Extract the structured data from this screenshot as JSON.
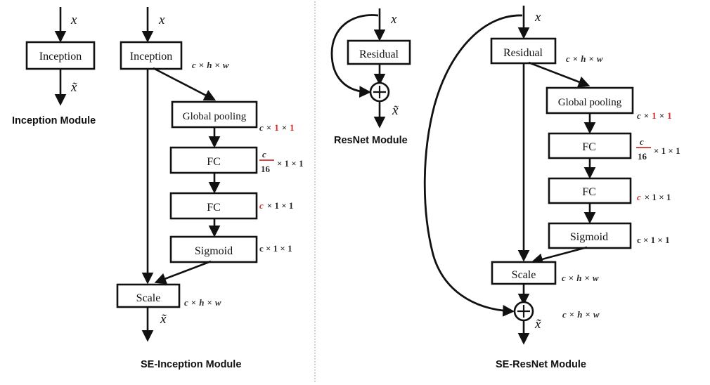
{
  "figure": {
    "panels": [
      {
        "id": "inception-module",
        "caption": "Inception Module",
        "input_var": "x",
        "output_var": "x̃",
        "blocks": [
          {
            "label": "Inception"
          }
        ]
      },
      {
        "id": "se-inception-module",
        "caption": "SE-Inception Module",
        "input_var": "x",
        "output_var": "x̃",
        "blocks": [
          {
            "label": "Inception",
            "dim": "c × h × w"
          },
          {
            "label": "Global pooling",
            "dim": "c × 1 × 1"
          },
          {
            "label": "FC",
            "dim": "c/16 × 1 × 1"
          },
          {
            "label": "FC",
            "dim": "c × 1 × 1"
          },
          {
            "label": "Sigmoid",
            "dim": "c × 1 × 1"
          },
          {
            "label": "Scale",
            "dim": "c × h × w"
          }
        ],
        "dims": {
          "after_inception": {
            "c": "c",
            "x1": "×",
            "h": "h",
            "x2": "×",
            "w": "w"
          },
          "after_pooling": {
            "c": "c",
            "x1": "×",
            "one1": "1",
            "x2": "×",
            "one2": "1"
          },
          "after_fc1": {
            "num": "c",
            "den": "16",
            "rest": "× 1 × 1"
          },
          "after_fc2": {
            "c": "c",
            "rest": "× 1 × 1"
          },
          "after_sigmoid": "c × 1 × 1",
          "after_scale": "c × h × w"
        }
      },
      {
        "id": "resnet-module",
        "caption": "ResNet Module",
        "input_var": "x",
        "output_var": "x̃",
        "sum_symbol": "+",
        "blocks": [
          {
            "label": "Residual"
          }
        ]
      },
      {
        "id": "se-resnet-module",
        "caption": "SE-ResNet Module",
        "input_var": "x",
        "output_var": "x̃",
        "sum_symbol": "+",
        "blocks": [
          {
            "label": "Residual",
            "dim": "c × h × w"
          },
          {
            "label": "Global pooling",
            "dim": "c × 1 × 1"
          },
          {
            "label": "FC",
            "dim": "c/16 × 1 × 1"
          },
          {
            "label": "FC",
            "dim": "c × 1 × 1"
          },
          {
            "label": "Sigmoid",
            "dim": "c × 1 × 1"
          },
          {
            "label": "Scale",
            "dim": "c × h × w"
          }
        ],
        "dims": {
          "after_residual": {
            "c": "c",
            "x1": "×",
            "h": "h",
            "x2": "×",
            "w": "w"
          },
          "after_pooling": {
            "c": "c",
            "x1": "×",
            "one1": "1",
            "x2": "×",
            "one2": "1"
          },
          "after_fc1": {
            "num": "c",
            "den": "16",
            "rest": "× 1 × 1"
          },
          "after_fc2": {
            "c": "c",
            "rest": "× 1 × 1"
          },
          "after_sigmoid": "c × 1 × 1",
          "after_scale": "c × h × w",
          "after_sum": "c × h × w"
        }
      }
    ],
    "colors": {
      "accent_red": "#d42b2b",
      "ink": "#111111",
      "divider": "#9aa8c7",
      "background": "#ffffff"
    }
  }
}
